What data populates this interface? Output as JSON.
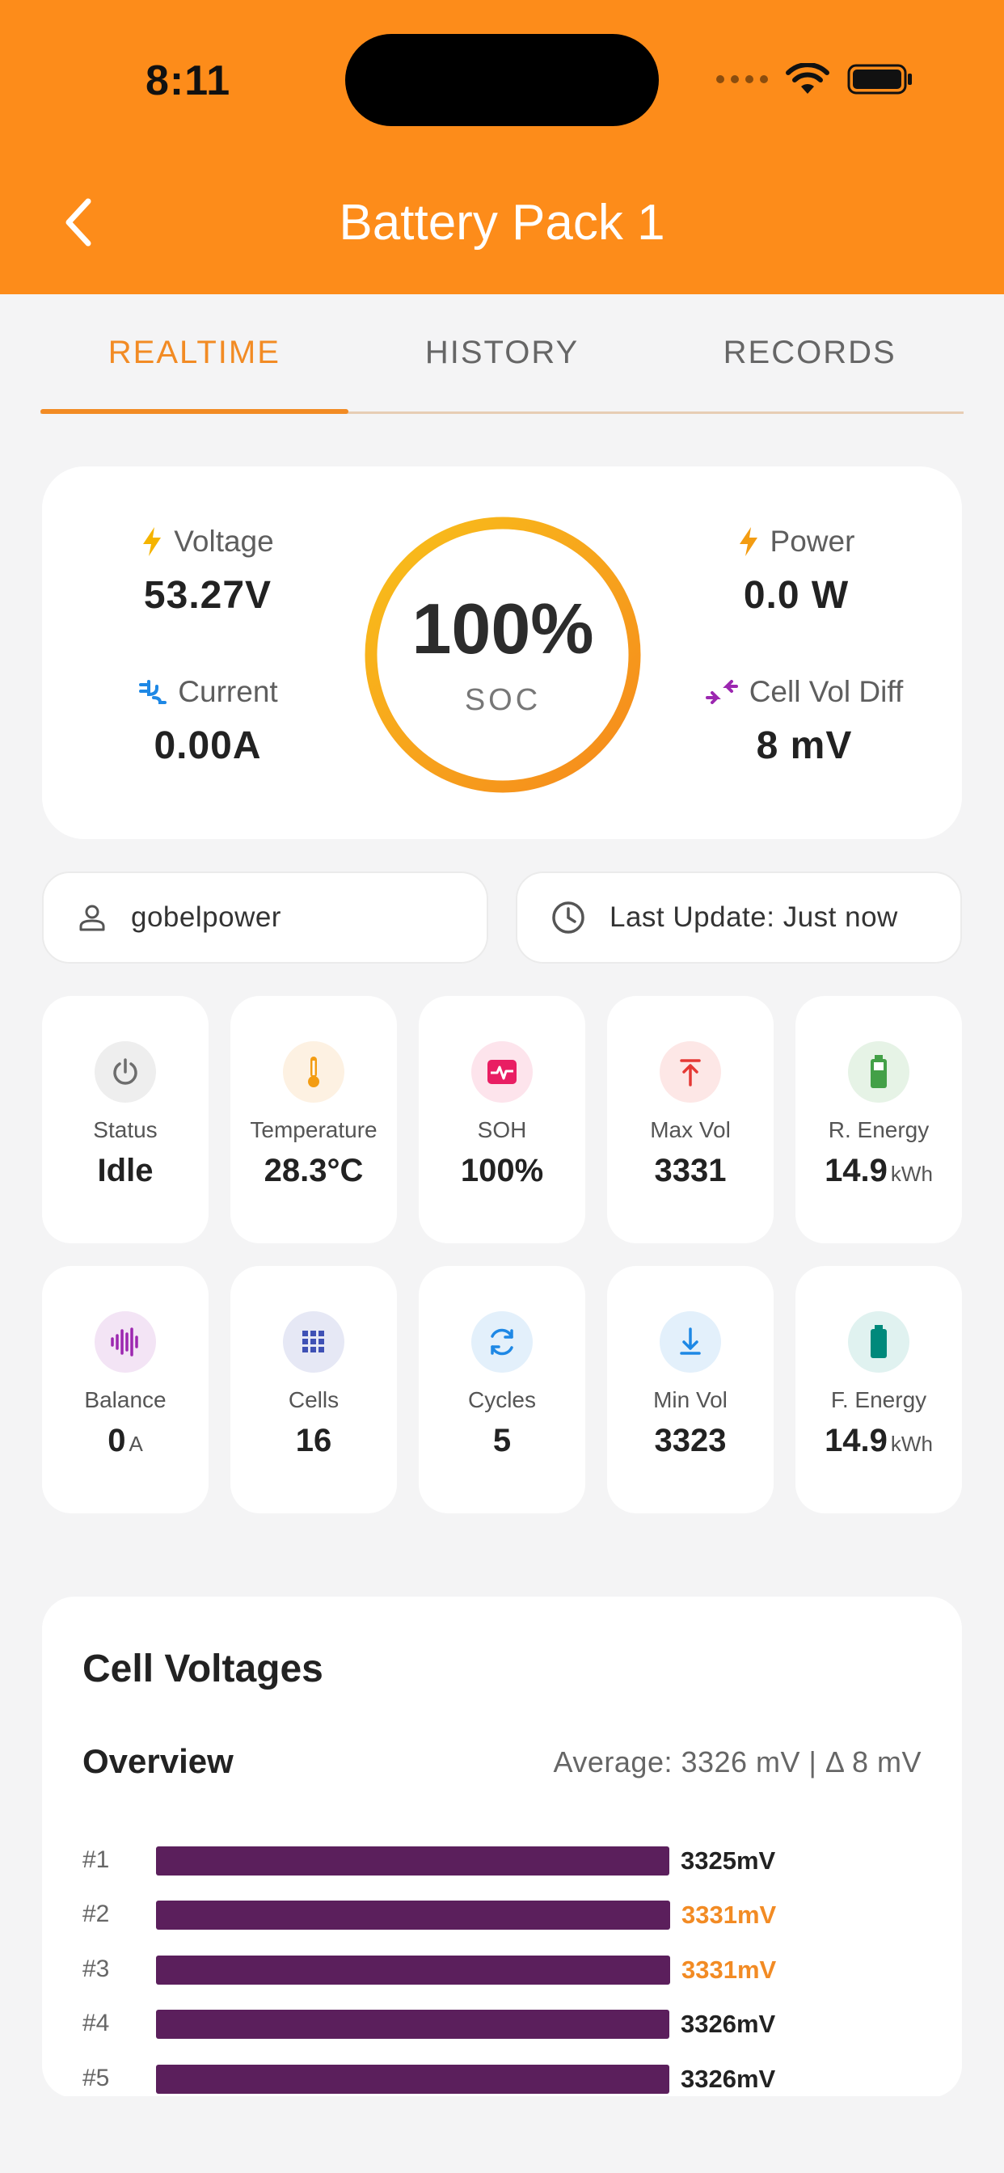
{
  "status_bar": {
    "time": "8:11"
  },
  "header": {
    "title": "Battery Pack 1"
  },
  "tabs": [
    {
      "label": "REALTIME",
      "active": true
    },
    {
      "label": "HISTORY",
      "active": false
    },
    {
      "label": "RECORDS",
      "active": false
    }
  ],
  "summary": {
    "voltage": {
      "label": "Voltage",
      "value": "53.27V",
      "icon": "bolt-icon"
    },
    "current": {
      "label": "Current",
      "value": "0.00A",
      "icon": "plug-icon"
    },
    "power": {
      "label": "Power",
      "value": "0.0 W",
      "icon": "bolt-icon"
    },
    "cell_vol_diff": {
      "label": "Cell Vol Diff",
      "value": "8 mV",
      "icon": "compress-arrows-icon"
    },
    "soc": {
      "value": "100%",
      "label": "SOC",
      "level": 1.0
    }
  },
  "info": {
    "user": "gobelpower",
    "last_update": "Last Update: Just now"
  },
  "tiles": [
    {
      "label": "Status",
      "value": "Idle",
      "unit": "",
      "icon": "power-icon",
      "color": "#6d6d6d",
      "bg": "#eeeeee"
    },
    {
      "label": "Temperature",
      "value": "28.3°C",
      "unit": "",
      "icon": "thermometer-icon",
      "color": "#f39c12",
      "bg": "#fdf1e2"
    },
    {
      "label": "SOH",
      "value": "100%",
      "unit": "",
      "icon": "heart-monitor-icon",
      "color": "#e91e63",
      "bg": "#fde4ec"
    },
    {
      "label": "Max Vol",
      "value": "3331",
      "unit": "",
      "icon": "arrow-up-icon",
      "color": "#e53935",
      "bg": "#fde7e6"
    },
    {
      "label": "R. Energy",
      "value": "14.9",
      "unit": "kWh",
      "icon": "battery-icon",
      "color": "#43a047",
      "bg": "#e6f3e6"
    },
    {
      "label": "Balance",
      "value": "0",
      "unit": "A",
      "icon": "equalizer-icon",
      "color": "#9c27b0",
      "bg": "#f3e4f5"
    },
    {
      "label": "Cells",
      "value": "16",
      "unit": "",
      "icon": "grid-icon",
      "color": "#3f51b5",
      "bg": "#e6e8f5"
    },
    {
      "label": "Cycles",
      "value": "5",
      "unit": "",
      "icon": "sync-icon",
      "color": "#1e88e5",
      "bg": "#e3f0fb"
    },
    {
      "label": "Min Vol",
      "value": "3323",
      "unit": "",
      "icon": "arrow-down-icon",
      "color": "#1e88e5",
      "bg": "#e3f0fb"
    },
    {
      "label": "F. Energy",
      "value": "14.9",
      "unit": "kWh",
      "icon": "battery-full-icon",
      "color": "#00897b",
      "bg": "#e0f2f0"
    }
  ],
  "cell_voltages": {
    "title": "Cell Voltages",
    "overview": "Overview",
    "summary": "Average: 3326 mV | Δ 8 mV",
    "cells": [
      {
        "num": "#1",
        "value": "3325mV",
        "mv": 3325,
        "max": false
      },
      {
        "num": "#2",
        "value": "3331mV",
        "mv": 3331,
        "max": true
      },
      {
        "num": "#3",
        "value": "3331mV",
        "mv": 3331,
        "max": true
      },
      {
        "num": "#4",
        "value": "3326mV",
        "mv": 3326,
        "max": false
      },
      {
        "num": "#5",
        "value": "3326mV",
        "mv": 3326,
        "max": false
      }
    ]
  }
}
